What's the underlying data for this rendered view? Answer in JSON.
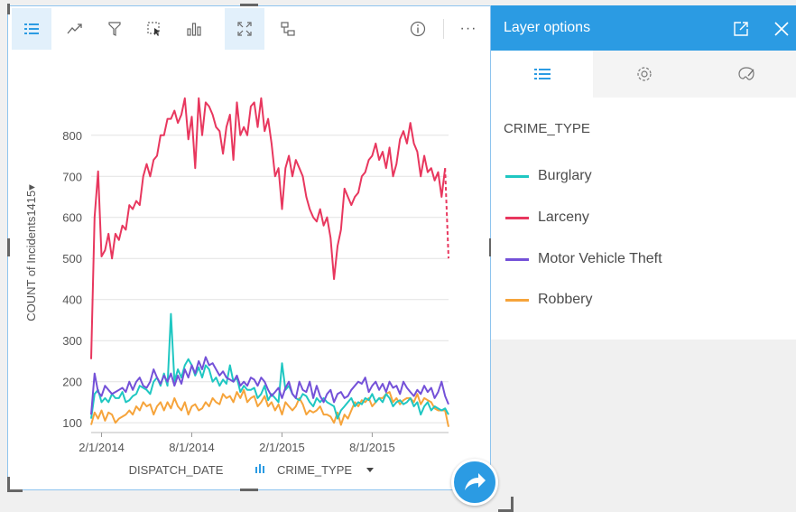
{
  "toolbar": {
    "icons": [
      "legend-icon",
      "trend-icon",
      "filter-icon",
      "select-icon",
      "bar-chart-icon",
      "expand-icon",
      "flip-card-icon",
      "info-icon",
      "more-icon"
    ],
    "more_label": "···"
  },
  "panel": {
    "title": "Layer options",
    "tabs": [
      "legend-icon",
      "gear-icon",
      "palette-icon"
    ],
    "legend_title": "CRIME_TYPE",
    "items": [
      {
        "label": "Burglary",
        "color": "#1fc7c2"
      },
      {
        "label": "Larceny",
        "color": "#e8375e"
      },
      {
        "label": "Motor Vehicle Theft",
        "color": "#7451d8"
      },
      {
        "label": "Robbery",
        "color": "#f6a43b"
      }
    ]
  },
  "axis": {
    "x_field": "DISPATCH_DATE",
    "y_field": "COUNT of Incidents1415",
    "color_field": "CRIME_TYPE"
  },
  "chart_data": {
    "type": "line",
    "xlabel": "DISPATCH_DATE",
    "ylabel": "COUNT of Incidents1415",
    "x_ticks": [
      "2/1/2014",
      "8/1/2014",
      "2/1/2015",
      "8/1/2015"
    ],
    "y_ticks": [
      100,
      200,
      300,
      400,
      500,
      600,
      700,
      800
    ],
    "ylim": [
      85,
      905
    ],
    "x_range_weeks": [
      0,
      103
    ],
    "x_tick_weeks": [
      3,
      29,
      55,
      81
    ],
    "grid": true,
    "series": [
      {
        "name": "Larceny",
        "color": "#e8375e",
        "dashed_last": true,
        "values": [
          255,
          600,
          712,
          505,
          520,
          560,
          500,
          560,
          545,
          580,
          570,
          630,
          620,
          640,
          630,
          700,
          730,
          700,
          740,
          750,
          800,
          800,
          840,
          840,
          860,
          830,
          850,
          890,
          790,
          845,
          720,
          890,
          800,
          880,
          870,
          850,
          820,
          810,
          755,
          820,
          850,
          740,
          880,
          800,
          820,
          800,
          870,
          880,
          820,
          890,
          810,
          840,
          780,
          700,
          720,
          620,
          720,
          750,
          700,
          740,
          720,
          700,
          650,
          620,
          600,
          590,
          620,
          580,
          600,
          550,
          450,
          530,
          570,
          670,
          650,
          630,
          650,
          660,
          700,
          710,
          740,
          750,
          780,
          740,
          760,
          720,
          770,
          700,
          730,
          790,
          810,
          780,
          830,
          780,
          760,
          700,
          750,
          710,
          720,
          690,
          710,
          650,
          720,
          500
        ]
      },
      {
        "name": "Burglary",
        "color": "#1fc7c2",
        "values": [
          110,
          170,
          180,
          150,
          160,
          150,
          170,
          160,
          160,
          175,
          150,
          155,
          165,
          170,
          190,
          185,
          180,
          170,
          200,
          210,
          190,
          220,
          190,
          365,
          200,
          230,
          210,
          240,
          255,
          240,
          215,
          235,
          210,
          240,
          230,
          200,
          210,
          190,
          205,
          195,
          240,
          200,
          210,
          175,
          190,
          180,
          180,
          185,
          160,
          170,
          190,
          155,
          170,
          160,
          150,
          245,
          180,
          190,
          170,
          160,
          155,
          170,
          165,
          150,
          140,
          160,
          150,
          160,
          150,
          145,
          140,
          110,
          130,
          140,
          150,
          160,
          140,
          150,
          145,
          160,
          155,
          170,
          150,
          160,
          150,
          170,
          160,
          140,
          150,
          155,
          145,
          150,
          160,
          140,
          150,
          120,
          140,
          150,
          130,
          140,
          135,
          130,
          135,
          120
        ]
      },
      {
        "name": "Motor Vehicle Theft",
        "color": "#7451d8",
        "values": [
          120,
          220,
          175,
          165,
          190,
          180,
          170,
          175,
          180,
          185,
          175,
          200,
          180,
          200,
          210,
          190,
          185,
          200,
          230,
          210,
          195,
          215,
          200,
          220,
          190,
          215,
          195,
          230,
          210,
          240,
          220,
          250,
          230,
          260,
          240,
          245,
          230,
          215,
          225,
          210,
          205,
          200,
          215,
          190,
          200,
          190,
          210,
          205,
          190,
          210,
          200,
          180,
          165,
          175,
          185,
          160,
          185,
          200,
          170,
          160,
          200,
          180,
          175,
          200,
          160,
          190,
          165,
          150,
          170,
          180,
          150,
          170,
          175,
          160,
          165,
          180,
          190,
          200,
          195,
          210,
          175,
          190,
          200,
          180,
          195,
          175,
          200,
          185,
          190,
          170,
          200,
          185,
          175,
          165,
          180,
          170,
          190,
          175,
          185,
          160,
          175,
          200,
          165,
          145
        ]
      },
      {
        "name": "Robbery",
        "color": "#f6a43b",
        "values": [
          95,
          125,
          110,
          130,
          105,
          125,
          120,
          100,
          110,
          115,
          120,
          130,
          120,
          140,
          130,
          150,
          140,
          145,
          120,
          140,
          150,
          130,
          150,
          135,
          160,
          140,
          130,
          150,
          120,
          140,
          145,
          130,
          135,
          150,
          140,
          160,
          150,
          145,
          170,
          160,
          165,
          150,
          175,
          160,
          180,
          150,
          160,
          165,
          140,
          150,
          165,
          140,
          150,
          130,
          145,
          120,
          150,
          140,
          130,
          140,
          160,
          145,
          120,
          130,
          125,
          130,
          140,
          120,
          120,
          115,
          100,
          125,
          95,
          120,
          110,
          130,
          150,
          140,
          155,
          150,
          160,
          140,
          150,
          160,
          160,
          170,
          175,
          150,
          160,
          145,
          155,
          160,
          160,
          150,
          170,
          145,
          160,
          155,
          150,
          135,
          130,
          130,
          130,
          90
        ]
      }
    ]
  }
}
